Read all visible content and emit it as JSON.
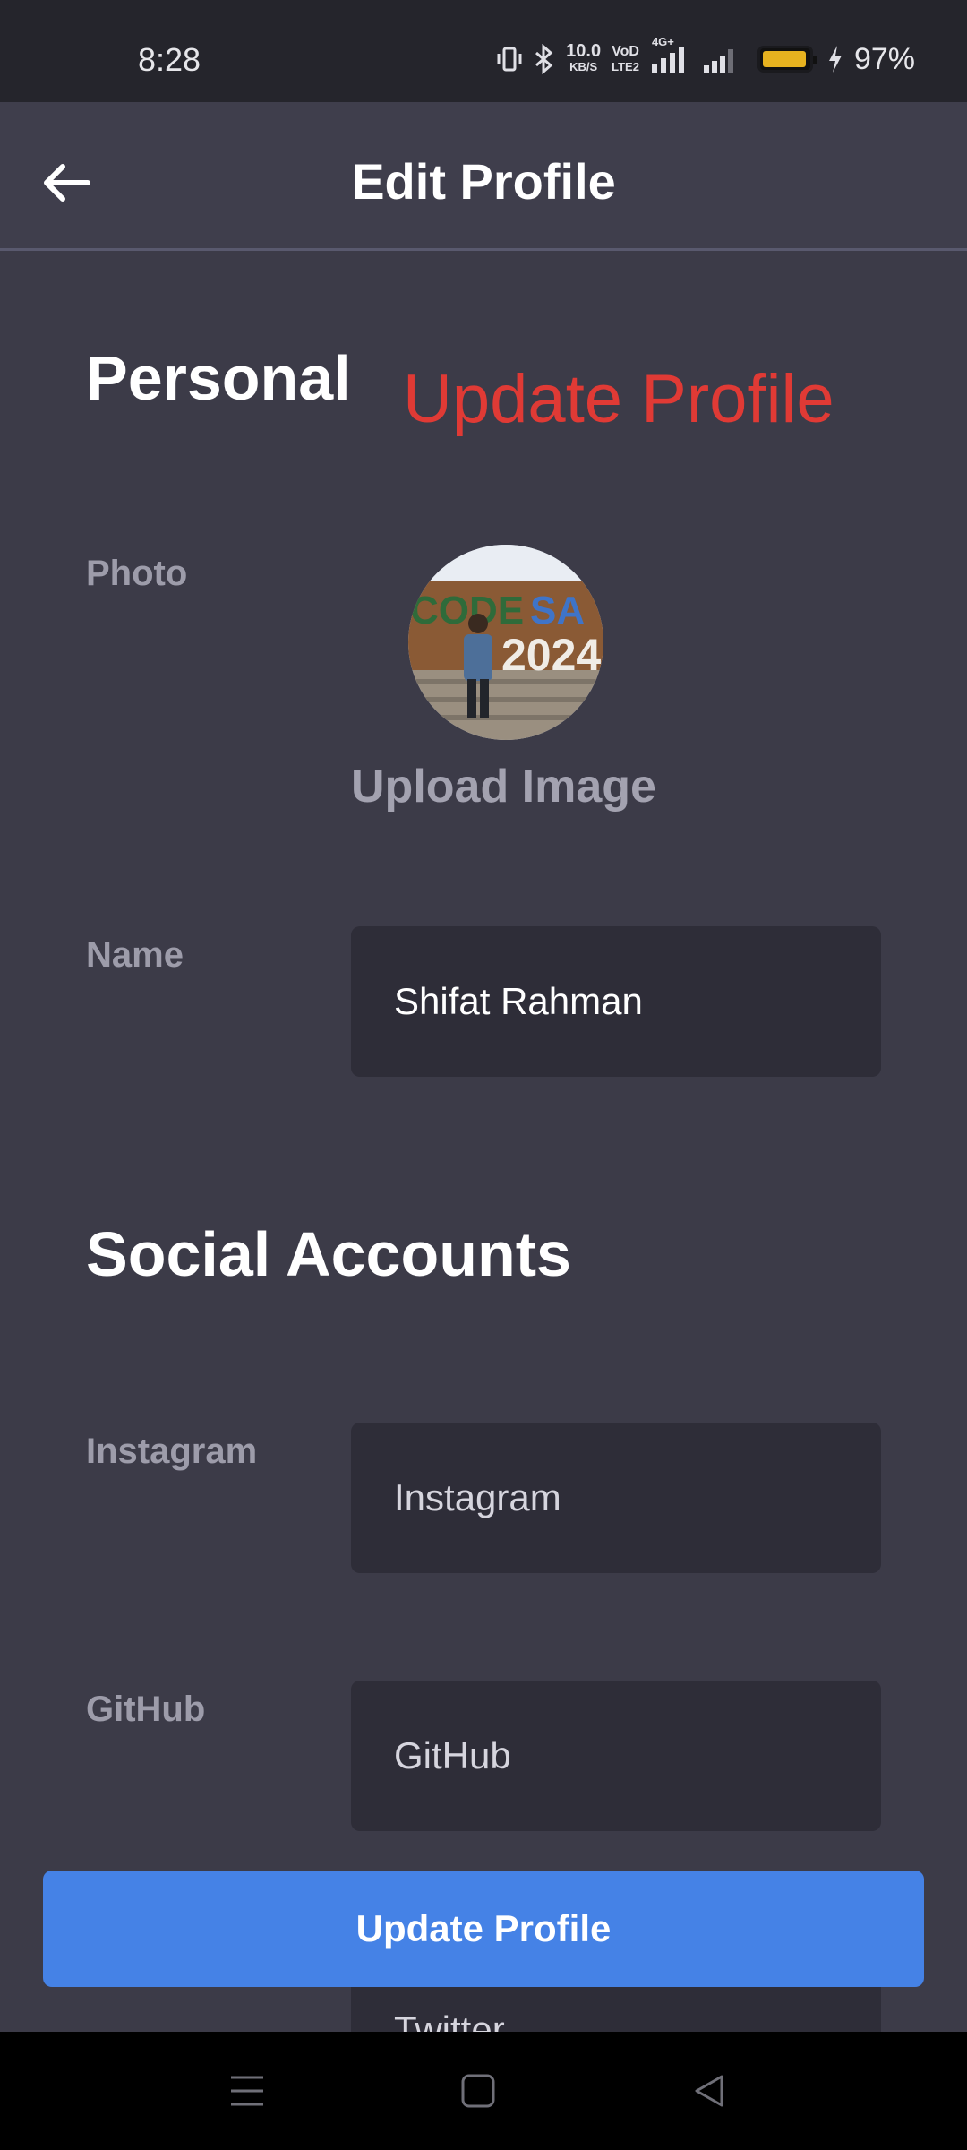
{
  "status_bar": {
    "time": "8:28",
    "net_speed_top": "10.0",
    "net_speed_bottom": "KB/S",
    "volte_top": "VoD",
    "volte_bottom": "LTE2",
    "network_type": "4G+",
    "battery_percent": "97%",
    "battery_level": 0.97,
    "battery_color": "#e6b21f",
    "icons": [
      "vibrate-icon",
      "bluetooth-icon",
      "signal-icon",
      "signal-icon",
      "charging-icon"
    ]
  },
  "app_bar": {
    "title": "Edit Profile",
    "back_icon": "arrow-left-icon"
  },
  "overlay": {
    "text": "Update Profile",
    "color": "#e03a35"
  },
  "personal": {
    "section_title": "Personal",
    "photo_label": "Photo",
    "upload_label": "Upload Image",
    "avatar_text_left": "CODE",
    "avatar_text_right": "SA",
    "avatar_text_year": "2024",
    "name_label": "Name",
    "name_value": "Shifat Rahman"
  },
  "social": {
    "section_title": "Social Accounts",
    "instagram_label": "Instagram",
    "instagram_placeholder": "Instagram",
    "github_label": "GitHub",
    "github_placeholder": "GitHub",
    "twitter_placeholder": "Twitter"
  },
  "actions": {
    "update_label": "Update Profile",
    "accent_color": "#4582e6"
  },
  "nav_bar": {
    "icons": [
      "menu-icon",
      "home-square-icon",
      "back-triangle-icon"
    ]
  }
}
